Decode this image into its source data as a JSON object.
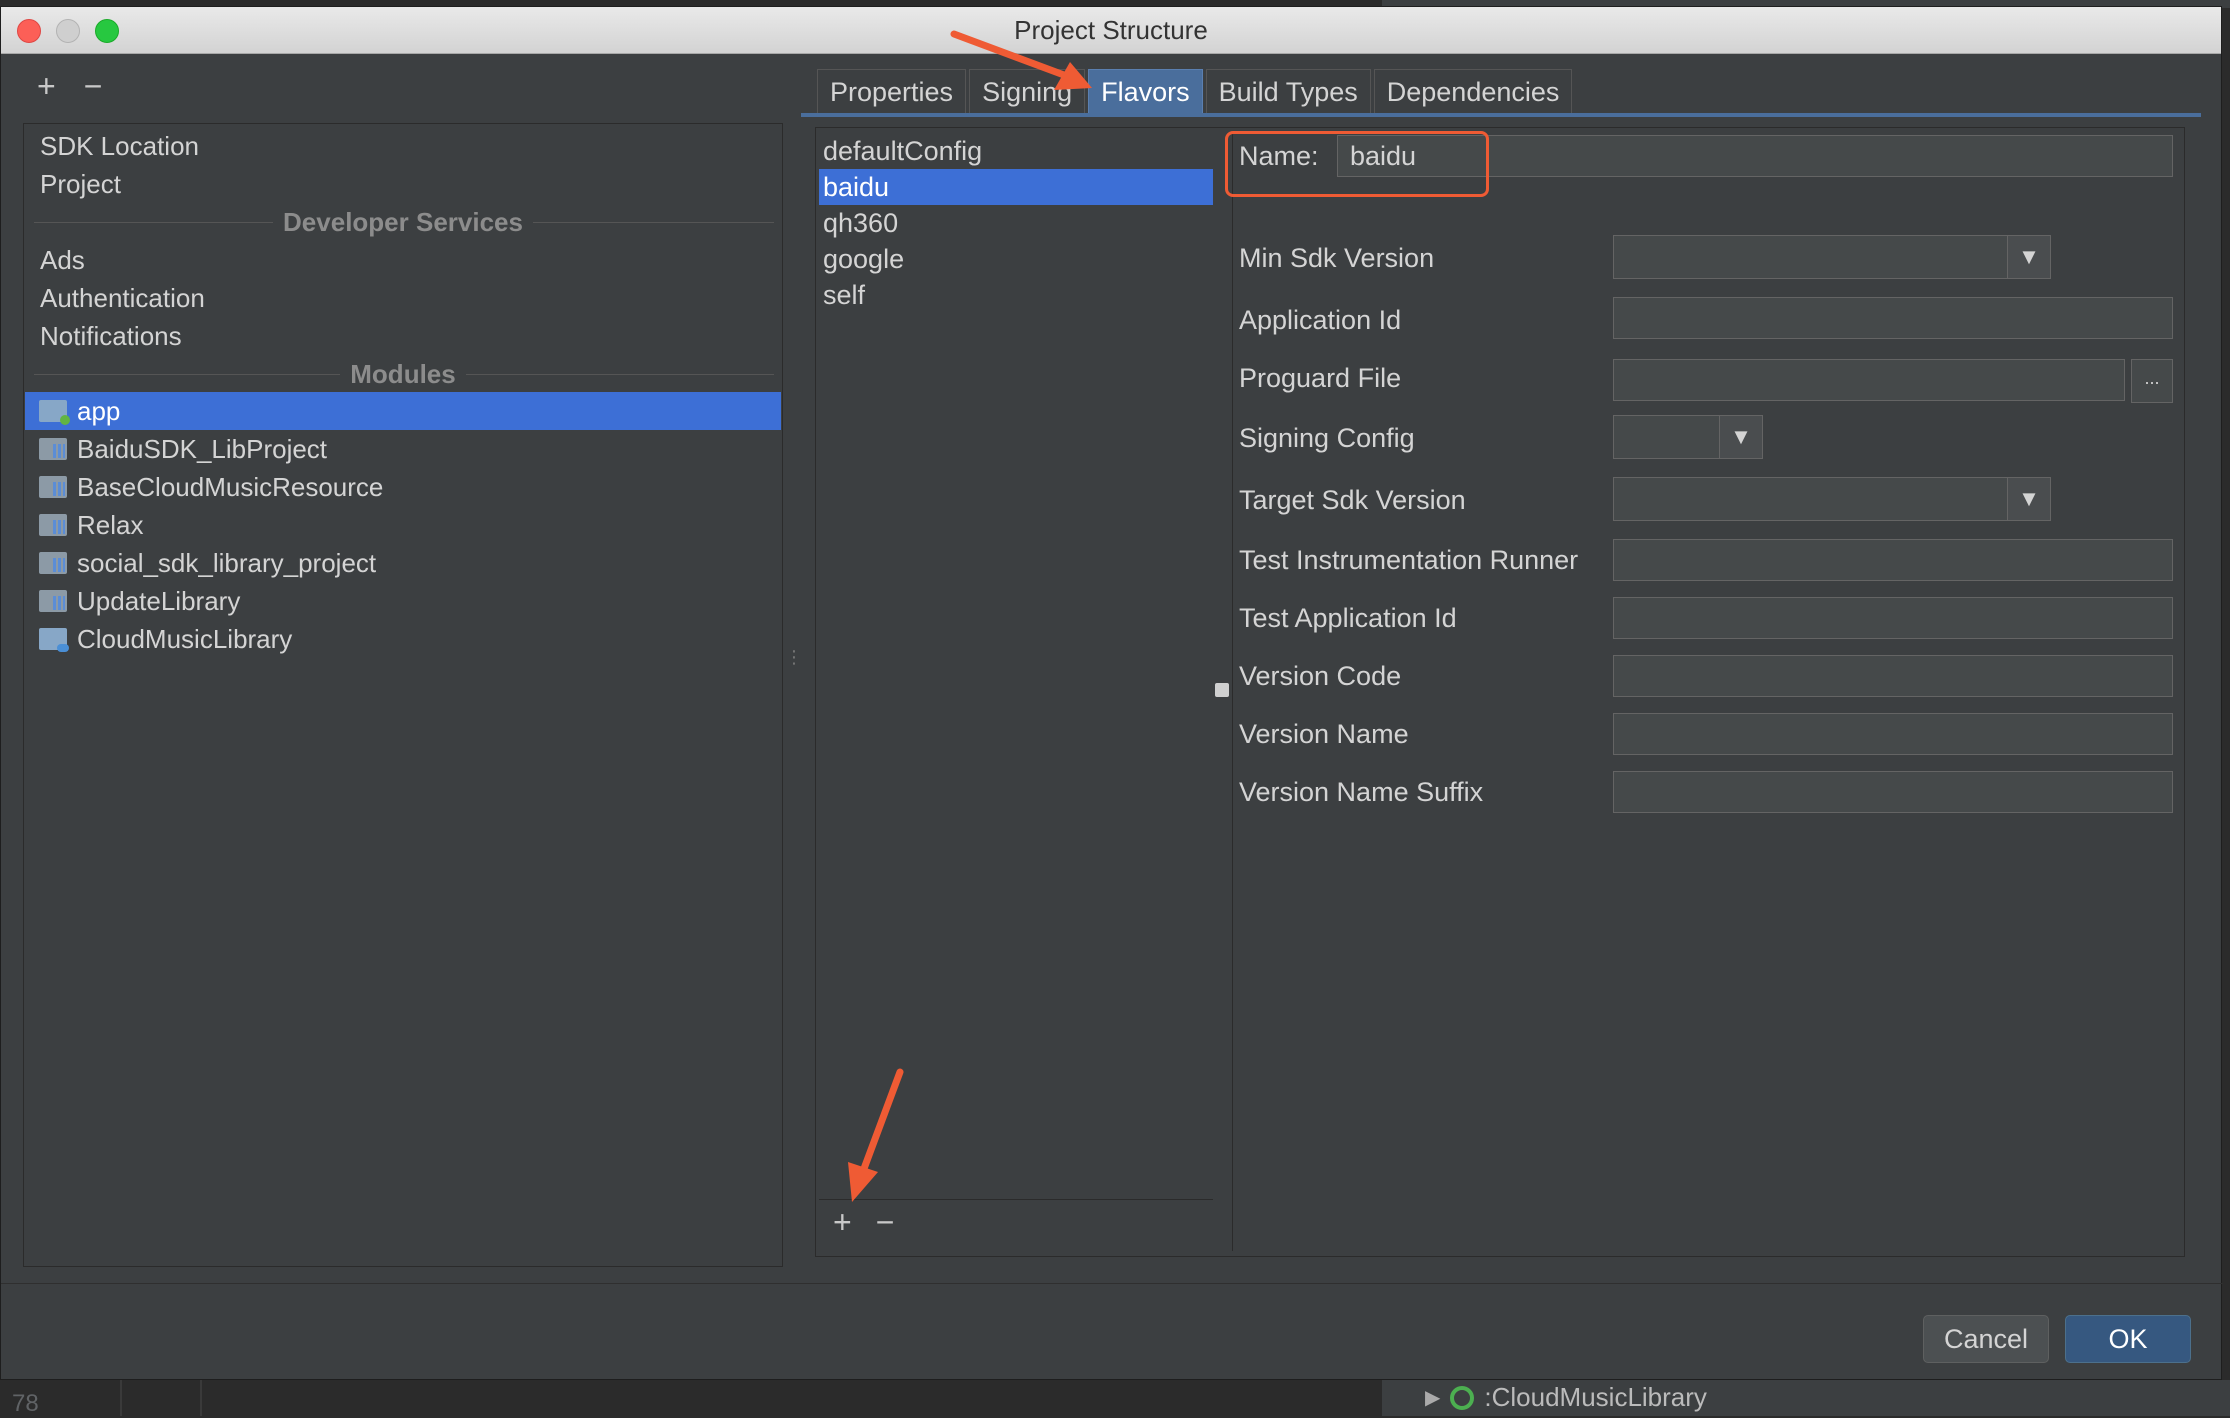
{
  "window": {
    "title": "Project Structure"
  },
  "left_toolbar": {
    "add": "+",
    "remove": "−"
  },
  "left_nav": {
    "items_top": [
      "SDK Location",
      "Project"
    ],
    "developer_services_header": "Developer Services",
    "developer_services": [
      "Ads",
      "Authentication",
      "Notifications"
    ],
    "modules_header": "Modules",
    "modules": [
      {
        "name": "app",
        "selected": true,
        "icon": "app-module-icon"
      },
      {
        "name": "BaiduSDK_LibProject",
        "selected": false,
        "icon": "library-module-icon"
      },
      {
        "name": "BaseCloudMusicResource",
        "selected": false,
        "icon": "library-module-icon"
      },
      {
        "name": "Relax",
        "selected": false,
        "icon": "library-module-icon"
      },
      {
        "name": "social_sdk_library_project",
        "selected": false,
        "icon": "library-module-icon"
      },
      {
        "name": "UpdateLibrary",
        "selected": false,
        "icon": "library-module-icon"
      },
      {
        "name": "CloudMusicLibrary",
        "selected": false,
        "icon": "cloud-module-icon"
      }
    ]
  },
  "tabs": [
    {
      "label": "Properties",
      "active": false
    },
    {
      "label": "Signing",
      "active": false
    },
    {
      "label": "Flavors",
      "active": true
    },
    {
      "label": "Build Types",
      "active": false
    },
    {
      "label": "Dependencies",
      "active": false
    }
  ],
  "flavors": {
    "items": [
      {
        "name": "defaultConfig",
        "selected": false
      },
      {
        "name": "baidu",
        "selected": true
      },
      {
        "name": "qh360",
        "selected": false
      },
      {
        "name": "google",
        "selected": false
      },
      {
        "name": "self",
        "selected": false
      }
    ],
    "add": "+",
    "remove": "−"
  },
  "form": {
    "name_label": "Name:",
    "name_value": "baidu",
    "fields": {
      "min_sdk_version": {
        "label": "Min Sdk Version",
        "value": ""
      },
      "application_id": {
        "label": "Application Id",
        "value": ""
      },
      "proguard_file": {
        "label": "Proguard File",
        "value": "",
        "browse": "..."
      },
      "signing_config": {
        "label": "Signing Config",
        "value": ""
      },
      "target_sdk_version": {
        "label": "Target Sdk Version",
        "value": ""
      },
      "test_instrumentation_runner": {
        "label": "Test Instrumentation Runner",
        "value": ""
      },
      "test_application_id": {
        "label": "Test Application Id",
        "value": ""
      },
      "version_code": {
        "label": "Version Code",
        "value": ""
      },
      "version_name": {
        "label": "Version Name",
        "value": ""
      },
      "version_name_suffix": {
        "label": "Version Name Suffix",
        "value": ""
      }
    }
  },
  "buttons": {
    "cancel": "Cancel",
    "ok": "OK"
  },
  "background_ide": {
    "line_number": "78",
    "tree_item": ":CloudMusicLibrary"
  },
  "colors": {
    "selection": "#3d6fd6",
    "annotation": "#ef5b34",
    "ok_button": "#365880"
  }
}
